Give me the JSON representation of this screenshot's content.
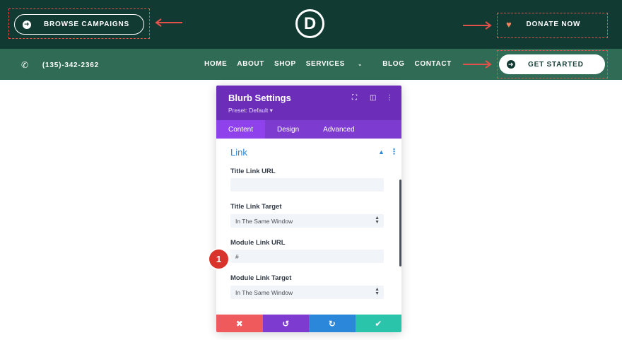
{
  "header": {
    "browse_label": "BROWSE CAMPAIGNS",
    "logo_letter": "D",
    "donate_label": "DONATE NOW"
  },
  "nav": {
    "phone": "(135)-342-2362",
    "menu": [
      "HOME",
      "ABOUT",
      "SHOP",
      "SERVICES",
      "BLOG",
      "CONTACT"
    ],
    "get_started_label": "GET STARTED"
  },
  "panel": {
    "title": "Blurb Settings",
    "preset": "Preset: Default ▾",
    "tabs": [
      "Content",
      "Design",
      "Advanced"
    ],
    "active_tab": "Content",
    "section_title": "Link",
    "fields": {
      "title_link_url_label": "Title Link URL",
      "title_link_url_value": "",
      "title_link_target_label": "Title Link Target",
      "title_link_target_value": "In The Same Window",
      "module_link_url_label": "Module Link URL",
      "module_link_url_value": "#",
      "module_link_target_label": "Module Link Target",
      "module_link_target_value": "In The Same Window"
    },
    "actions": [
      "cancel",
      "undo",
      "redo",
      "save"
    ]
  },
  "badge": "1",
  "colors": {
    "topbar": "#113a32",
    "navbar": "#2f6b55",
    "panel_header": "#6c2eb9",
    "tabs_bar": "#7e3bd0",
    "accent_blue": "#2b87da",
    "annotation_red": "#e2524a",
    "cancel": "#ef5a5c",
    "undo": "#7e3bd0",
    "redo": "#2b87da",
    "save": "#29c4a9"
  }
}
